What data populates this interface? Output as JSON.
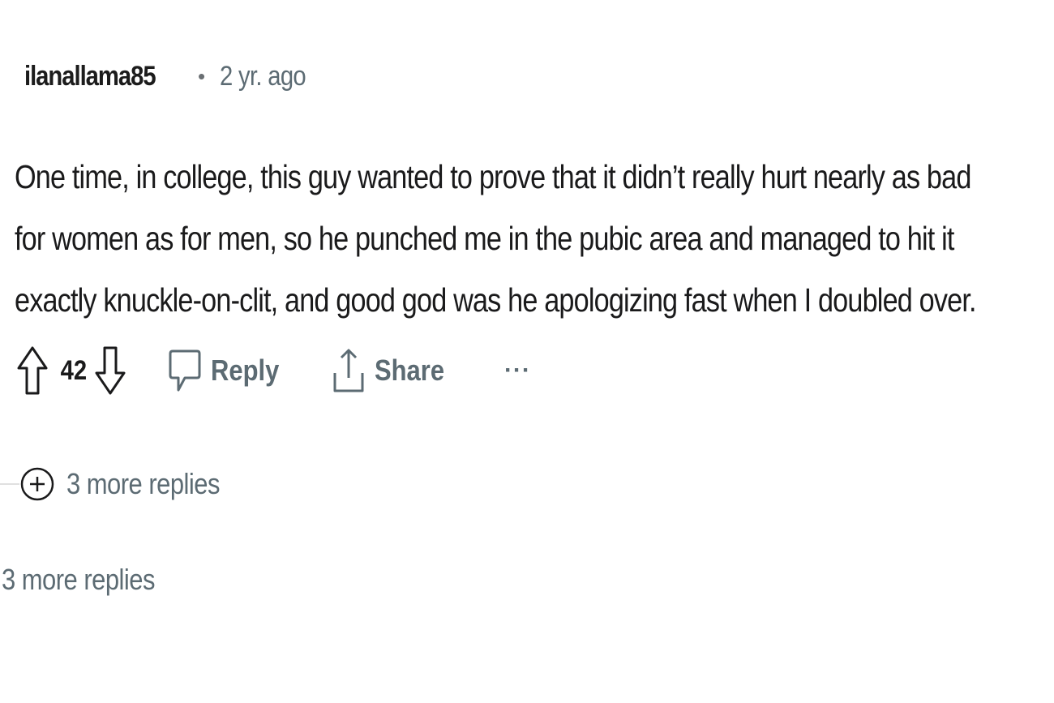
{
  "comment": {
    "username": "ilanallama85",
    "separator": "•",
    "timestamp": "2 yr. ago",
    "body_lines": [
      "One time, in college, this guy wanted to prove that it didn’t really hurt nearly as bad",
      "for women as for men, so he punched me in the pubic area and managed to hit it",
      "exactly knuckle-on-clit, and good god was he apologizing fast when I doubled over."
    ],
    "actions": {
      "vote_count": "42",
      "reply_label": "Reply",
      "share_label": "Share",
      "more_label": "···",
      "upvote_icon": "arrow-up-outline",
      "downvote_icon": "arrow-down-outline",
      "reply_icon": "speech-bubble-outline",
      "share_icon": "share-upload-outline"
    }
  },
  "nested_more_replies": {
    "label": "3 more replies",
    "icon": "plus-circle"
  },
  "top_more_replies": {
    "label": "3 more replies"
  },
  "colors": {
    "text": "#1a1a1b",
    "muted": "#5c6b73",
    "background": "#ffffff"
  }
}
